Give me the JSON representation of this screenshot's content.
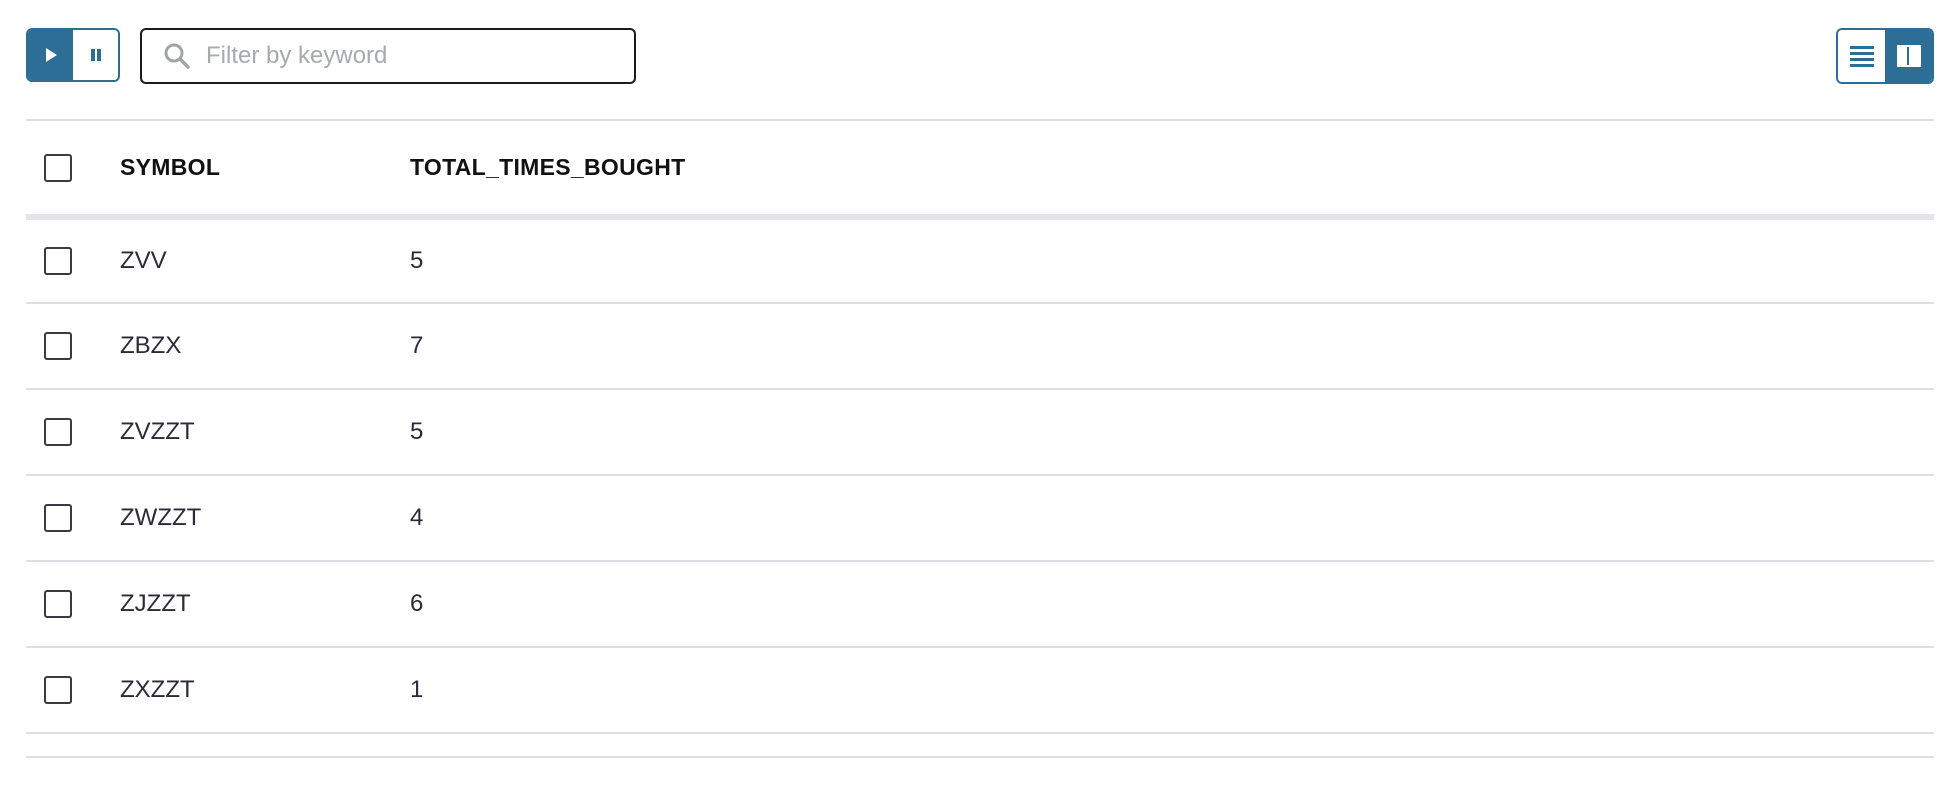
{
  "toolbar": {
    "play_icon": "play-icon",
    "pause_icon": "pause-icon",
    "search_placeholder": "Filter by keyword",
    "search_value": "",
    "list_view_icon": "list-view-icon",
    "split_view_icon": "split-view-icon",
    "accent_color": "#2c6e96"
  },
  "table": {
    "columns": [
      "SYMBOL",
      "TOTAL_TIMES_BOUGHT"
    ],
    "rows": [
      {
        "symbol": "ZVV",
        "total_times_bought": "5"
      },
      {
        "symbol": "ZBZX",
        "total_times_bought": "7"
      },
      {
        "symbol": "ZVZZT",
        "total_times_bought": "5"
      },
      {
        "symbol": "ZWZZT",
        "total_times_bought": "4"
      },
      {
        "symbol": "ZJZZT",
        "total_times_bought": "6"
      },
      {
        "symbol": "ZXZZT",
        "total_times_bought": "1"
      }
    ]
  }
}
